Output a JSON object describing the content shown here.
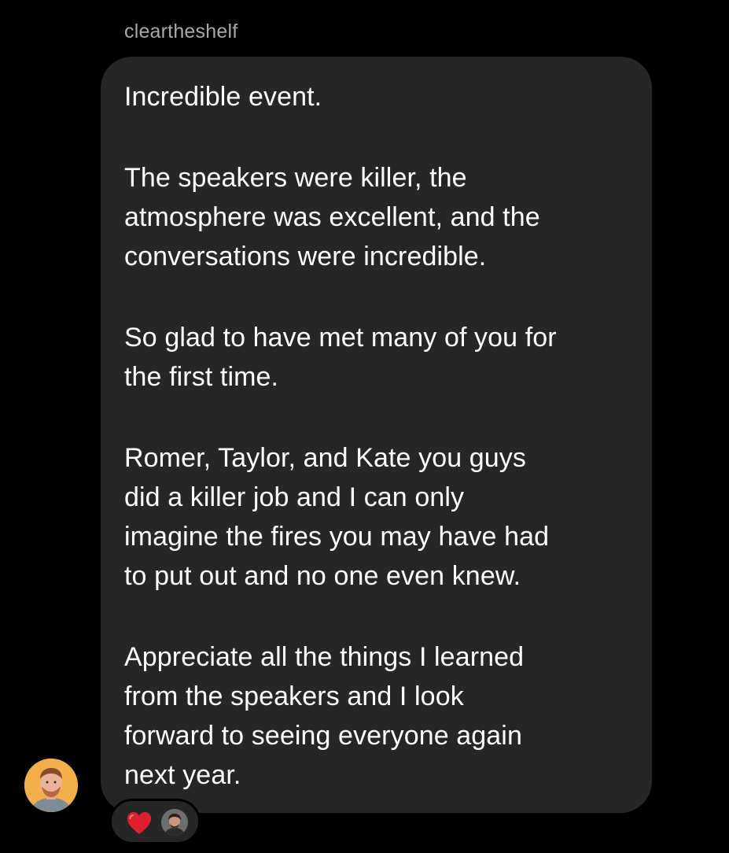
{
  "message": {
    "sender": "cleartheshelf",
    "paragraphs": [
      [
        "Incredible event."
      ],
      [
        "The speakers were killer, the",
        "atmosphere was excellent, and the",
        "conversations were incredible."
      ],
      [
        "So glad to have met many of you for",
        "the first time."
      ],
      [
        "Romer, Taylor, and Kate you guys",
        "did a killer job and I can only",
        "imagine the fires you may have had",
        "to put out and no one even knew."
      ],
      [
        "Appreciate all the things I learned",
        "from the speakers and I look",
        "forward to seeing everyone again",
        "next year."
      ]
    ]
  },
  "reactions": {
    "emoji": "heart-icon",
    "reactor_avatar": "reactor-avatar"
  },
  "colors": {
    "background": "#000000",
    "bubble": "#262626",
    "sender_text": "#a8a8a8",
    "message_text": "#ffffff",
    "heart": "#e0202f",
    "avatar_bg": "#f3b04a"
  }
}
